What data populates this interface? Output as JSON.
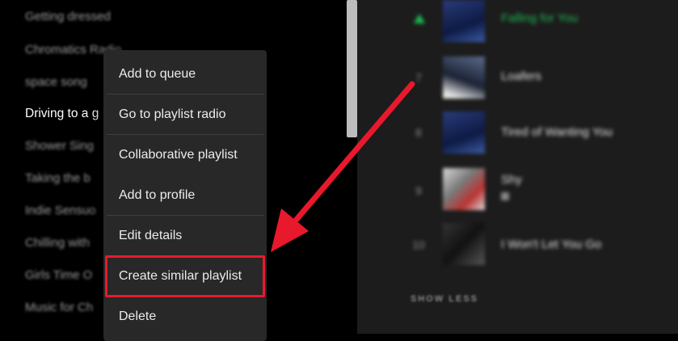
{
  "sidebar": {
    "playlists": [
      {
        "label": "Getting dressed",
        "active": false
      },
      {
        "label": "Chromatics Radio",
        "active": false
      },
      {
        "label": "space song",
        "active": false
      },
      {
        "label": "Driving to a g",
        "active": true
      },
      {
        "label": "Shower Sing",
        "active": false
      },
      {
        "label": "Taking the b",
        "active": false
      },
      {
        "label": "Indie Sensuo",
        "active": false
      },
      {
        "label": "Chilling with",
        "active": false
      },
      {
        "label": "Girls Time O",
        "active": false
      },
      {
        "label": "Music for Ch",
        "active": false
      }
    ]
  },
  "context_menu": {
    "items": [
      {
        "label": "Add to queue"
      },
      {
        "label": "Go to playlist radio"
      },
      {
        "label": "Collaborative playlist"
      },
      {
        "label": "Add to profile"
      },
      {
        "label": "Edit details"
      },
      {
        "label": "Create similar playlist",
        "highlighted": true
      },
      {
        "label": "Delete"
      }
    ]
  },
  "tracks": [
    {
      "number": "",
      "title": "Falling for You",
      "playing": true
    },
    {
      "number": "7",
      "title": "Loafers",
      "playing": false
    },
    {
      "number": "8",
      "title": "Tired of Wanting You",
      "playing": false
    },
    {
      "number": "9",
      "title": "Shy",
      "playing": false,
      "explicit_badge": true
    },
    {
      "number": "10",
      "title": "I Won't Let You Go",
      "playing": false
    }
  ],
  "show_less_label": "SHOW LESS",
  "colors": {
    "accent_green": "#1db954",
    "highlight_red": "#e8192c",
    "menu_bg": "#282828"
  }
}
